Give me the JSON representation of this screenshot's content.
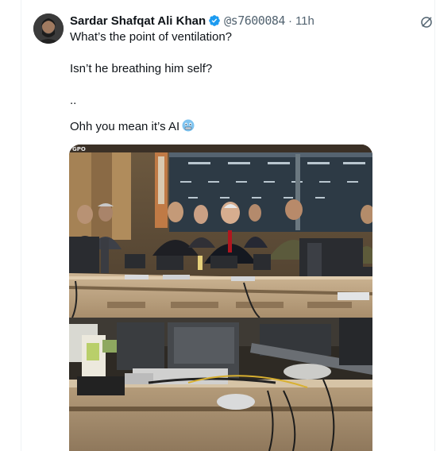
{
  "tweet": {
    "author_name": "Sardar Shafqat Ali Khan",
    "handle": "@s7600084",
    "separator": "·",
    "time": "11h",
    "lines": [
      "What’s the point of ventilation?",
      "Isn’t he breathing him self?",
      "..",
      "Ohh you mean it’s AI"
    ],
    "media_watermark": "GPO"
  },
  "icons": {
    "verified": "verified-badge-icon",
    "grok": "grok-icon",
    "emoji": "cold-face-emoji"
  },
  "colors": {
    "verified_blue": "#1d9bf0",
    "secondary_text": "#536471",
    "emoji_blue": "#7fc4f0"
  }
}
